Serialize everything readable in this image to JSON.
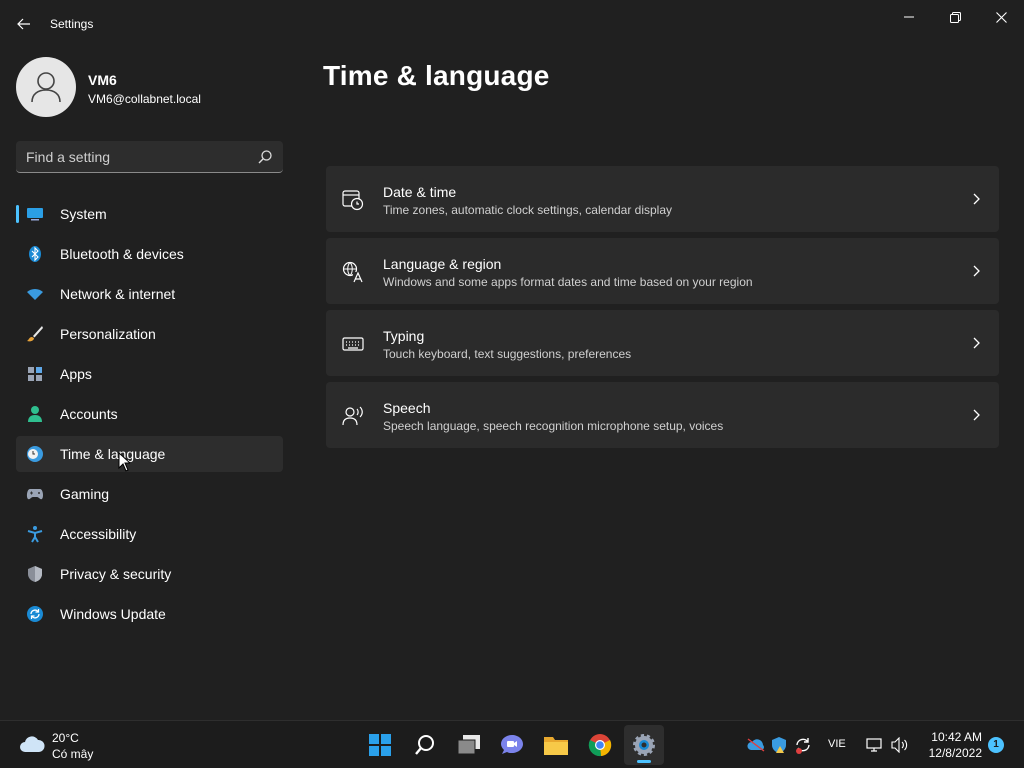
{
  "window": {
    "title": "Settings"
  },
  "user": {
    "name": "VM6",
    "email": "VM6@collabnet.local"
  },
  "search": {
    "placeholder": "Find a setting"
  },
  "sidebar": {
    "items": [
      {
        "label": "System",
        "icon": "system-icon"
      },
      {
        "label": "Bluetooth & devices",
        "icon": "bluetooth-icon"
      },
      {
        "label": "Network & internet",
        "icon": "wifi-icon"
      },
      {
        "label": "Personalization",
        "icon": "brush-icon"
      },
      {
        "label": "Apps",
        "icon": "apps-icon"
      },
      {
        "label": "Accounts",
        "icon": "accounts-icon"
      },
      {
        "label": "Time & language",
        "icon": "time-language-icon",
        "selected": true
      },
      {
        "label": "Gaming",
        "icon": "gamepad-icon"
      },
      {
        "label": "Accessibility",
        "icon": "accessibility-icon"
      },
      {
        "label": "Privacy & security",
        "icon": "shield-icon"
      },
      {
        "label": "Windows Update",
        "icon": "update-icon"
      }
    ]
  },
  "main": {
    "title": "Time & language",
    "cards": [
      {
        "title": "Date & time",
        "subtitle": "Time zones, automatic clock settings, calendar display",
        "icon": "clock-calendar-icon"
      },
      {
        "title": "Language & region",
        "subtitle": "Windows and some apps format dates and time based on your region",
        "icon": "language-icon"
      },
      {
        "title": "Typing",
        "subtitle": "Touch keyboard, text suggestions, preferences",
        "icon": "keyboard-icon"
      },
      {
        "title": "Speech",
        "subtitle": "Speech language, speech recognition microphone setup, voices",
        "icon": "speech-icon"
      }
    ]
  },
  "taskbar": {
    "weather": {
      "temp": "20°C",
      "condition": "Có mây"
    },
    "apps": [
      "start-icon",
      "search-icon",
      "task-view-icon",
      "chat-icon",
      "file-explorer-icon",
      "chrome-icon",
      "settings-icon"
    ],
    "active_app": "settings-icon",
    "language": "VIE",
    "time": "10:42 AM",
    "date": "12/8/2022",
    "notifications": "1"
  },
  "colors": {
    "background": "#202020",
    "card": "#2b2b2b",
    "accent": "#4cc2ff"
  }
}
